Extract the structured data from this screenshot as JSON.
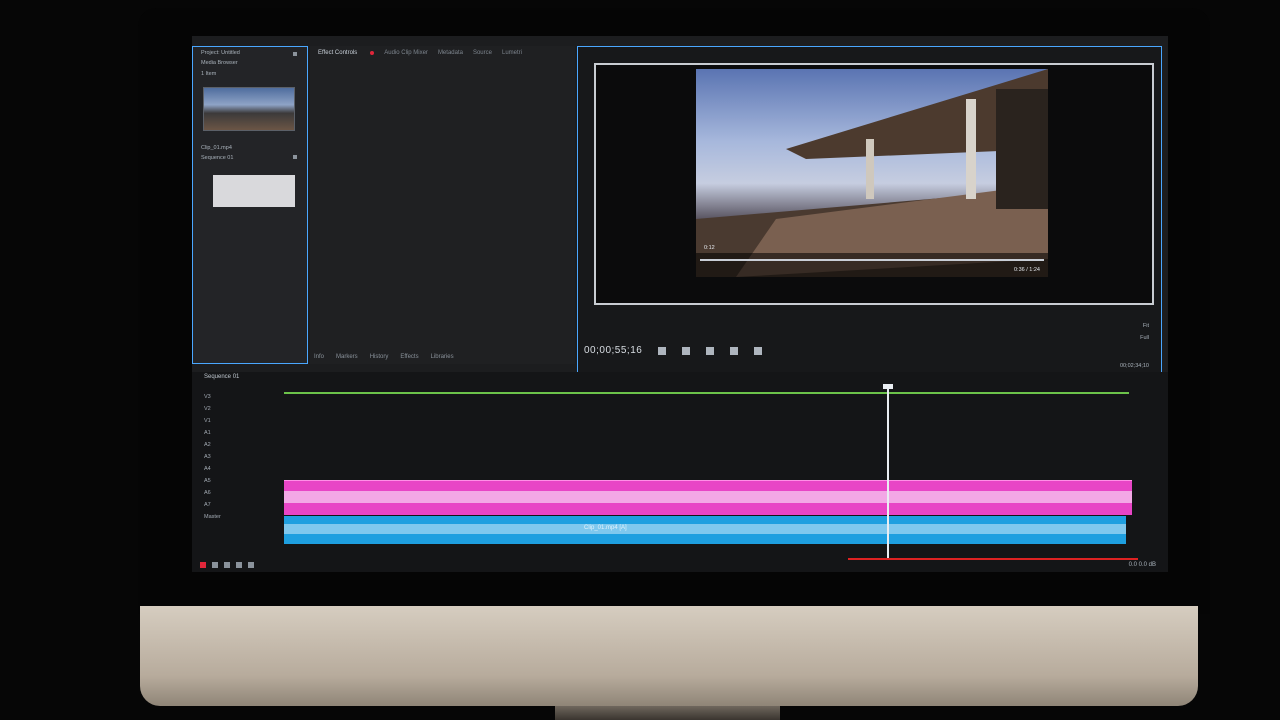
{
  "project_panel": {
    "title": "Project: Untitled",
    "subtitle": "Media Browser",
    "lines": [
      "1 Item",
      "Clip_01.mp4",
      "Sequence 01"
    ]
  },
  "source_panel": {
    "tabs": [
      "Effect Controls",
      "Audio Clip Mixer",
      "Metadata",
      "Source",
      "Lumetri"
    ],
    "bottom_tabs": [
      "Info",
      "Markers",
      "History",
      "Effects",
      "Libraries"
    ]
  },
  "program_panel": {
    "timecode": "00;00;55;16",
    "video_duration_label": "0:36 / 1:24",
    "video_time_label": "0:12",
    "fit_label": "Fit",
    "right_label_1": "Full",
    "right_label_2": "00;02;34;10"
  },
  "timeline": {
    "sequence_name": "Sequence 01",
    "tracks": [
      "V3",
      "V2",
      "V1",
      "A1",
      "A2",
      "A3",
      "A4",
      "A5",
      "A6",
      "A7",
      "Master"
    ],
    "audio_clip_label": "Clip_01.mp4 [A]",
    "footer_label": "0.0 0.0 dB"
  }
}
